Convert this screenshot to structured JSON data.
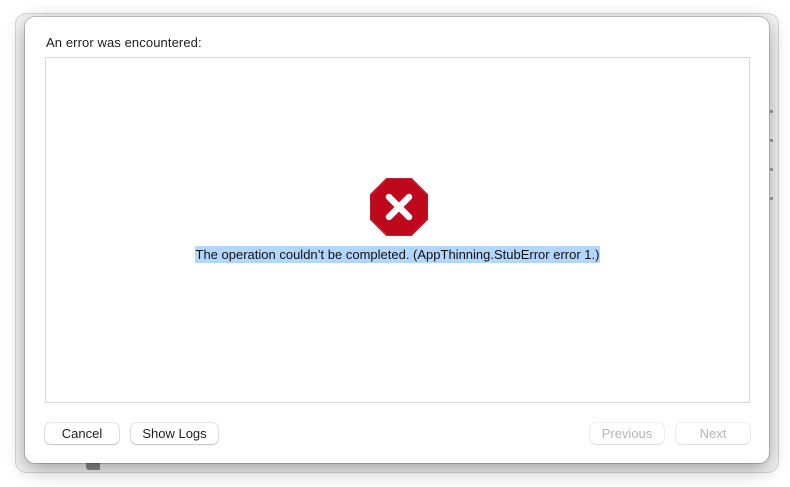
{
  "sheet": {
    "title": "An error was encountered:",
    "error_message": "The operation couldn’t be completed. (AppThinning.StubError error 1.)",
    "icon": "error-octagon-x-icon"
  },
  "buttons": {
    "cancel": "Cancel",
    "show_logs": "Show Logs",
    "previous": "Previous",
    "next": "Next"
  },
  "colors": {
    "error_red": "#c0081c",
    "selection_highlight": "#b2d6fd",
    "disabled_text": "#b4b4b4"
  }
}
